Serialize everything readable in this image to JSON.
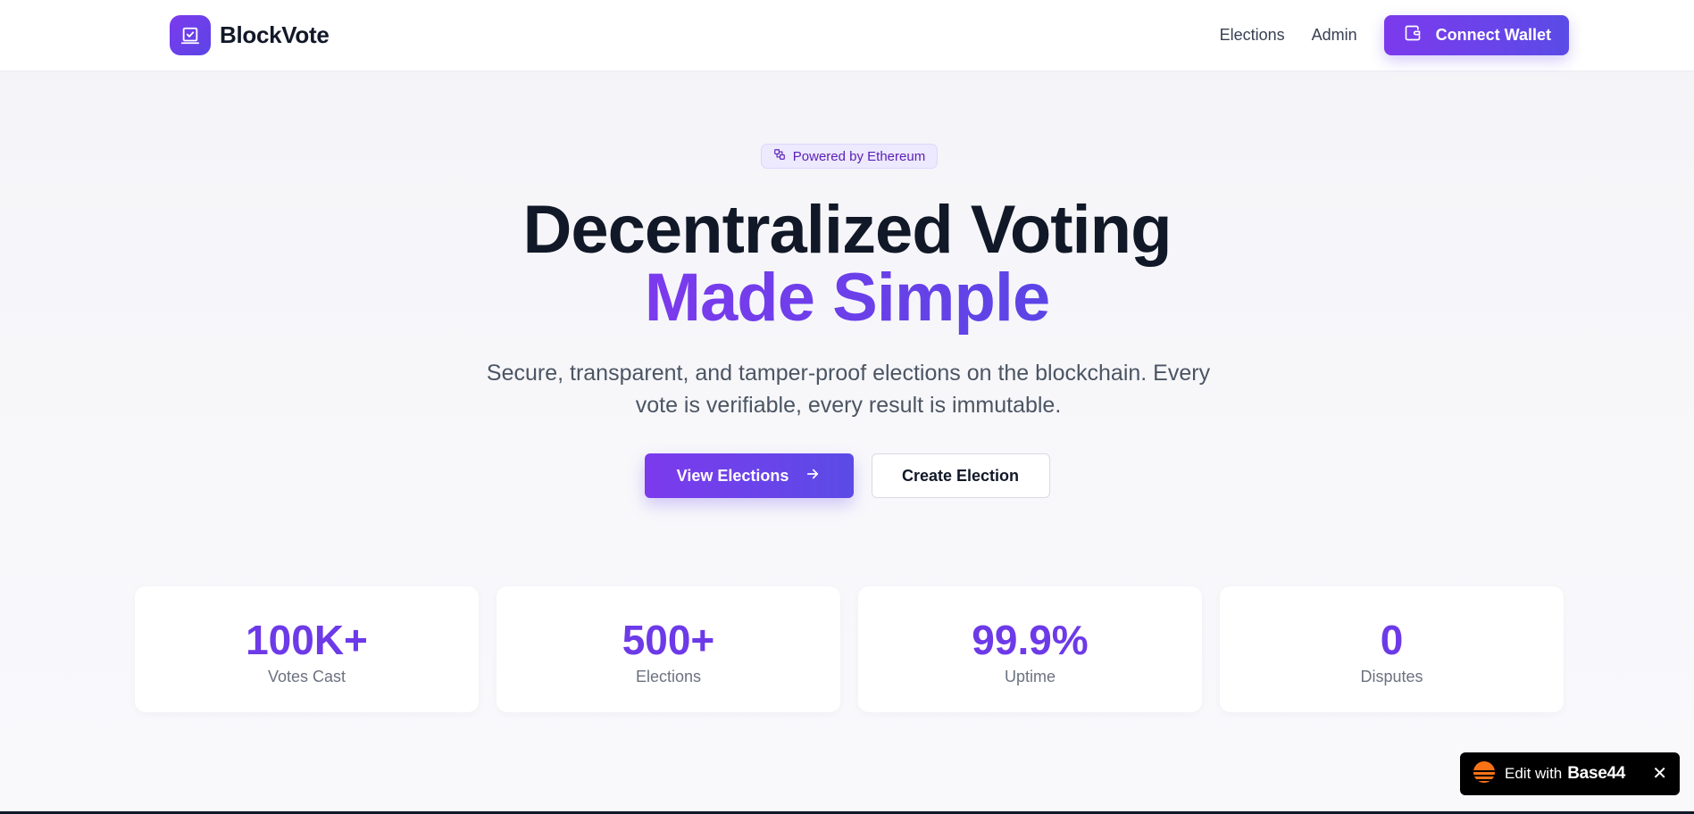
{
  "header": {
    "brand": "BlockVote",
    "nav": {
      "elections": "Elections",
      "admin": "Admin"
    },
    "connect_wallet": "Connect Wallet"
  },
  "hero": {
    "badge": "Powered by Ethereum",
    "title_line1": "Decentralized Voting",
    "title_line2": "Made Simple",
    "subtitle": "Secure, transparent, and tamper-proof elections on the blockchain. Every vote is verifiable, every result is immutable.",
    "primary_button": "View Elections",
    "secondary_button": "Create Election"
  },
  "stats": [
    {
      "value": "100K+",
      "label": "Votes Cast"
    },
    {
      "value": "500+",
      "label": "Elections"
    },
    {
      "value": "99.9%",
      "label": "Uptime"
    },
    {
      "value": "0",
      "label": "Disputes"
    }
  ],
  "toast": {
    "prefix": "Edit with",
    "brand": "Base44"
  },
  "colors": {
    "accent": "#7c3aed",
    "accent_end": "#5b45e6",
    "stat_value": "#6d3ae8"
  },
  "icons": {
    "logo": "vote-check-icon",
    "wallet": "wallet-icon",
    "badge": "blocks-icon",
    "arrow": "arrow-right-icon",
    "toast_logo": "base44-sun-icon",
    "close": "close-icon"
  }
}
